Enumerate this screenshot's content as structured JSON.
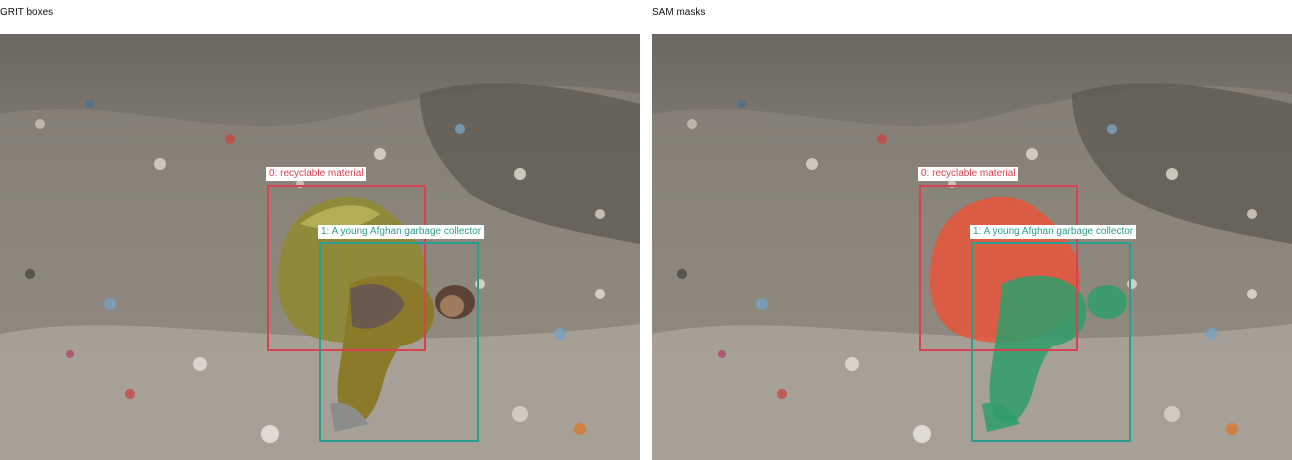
{
  "panels": [
    {
      "title": "GRIT boxes",
      "boxes": [
        {
          "label": "0: recyclable material",
          "color": "#d9414f"
        },
        {
          "label": "1: A young Afghan garbage collector",
          "color": "#2a9d8f"
        }
      ]
    },
    {
      "title": "SAM masks",
      "boxes": [
        {
          "label": "0: recyclable material",
          "color": "#d9414f"
        },
        {
          "label": "1: A young Afghan garbage collector",
          "color": "#2a9d8f"
        }
      ]
    }
  ],
  "colors": {
    "box_0": "#d9414f",
    "box_1": "#2a9d8f",
    "mask_0": "#e8553a",
    "mask_1": "#2f9e6a"
  }
}
